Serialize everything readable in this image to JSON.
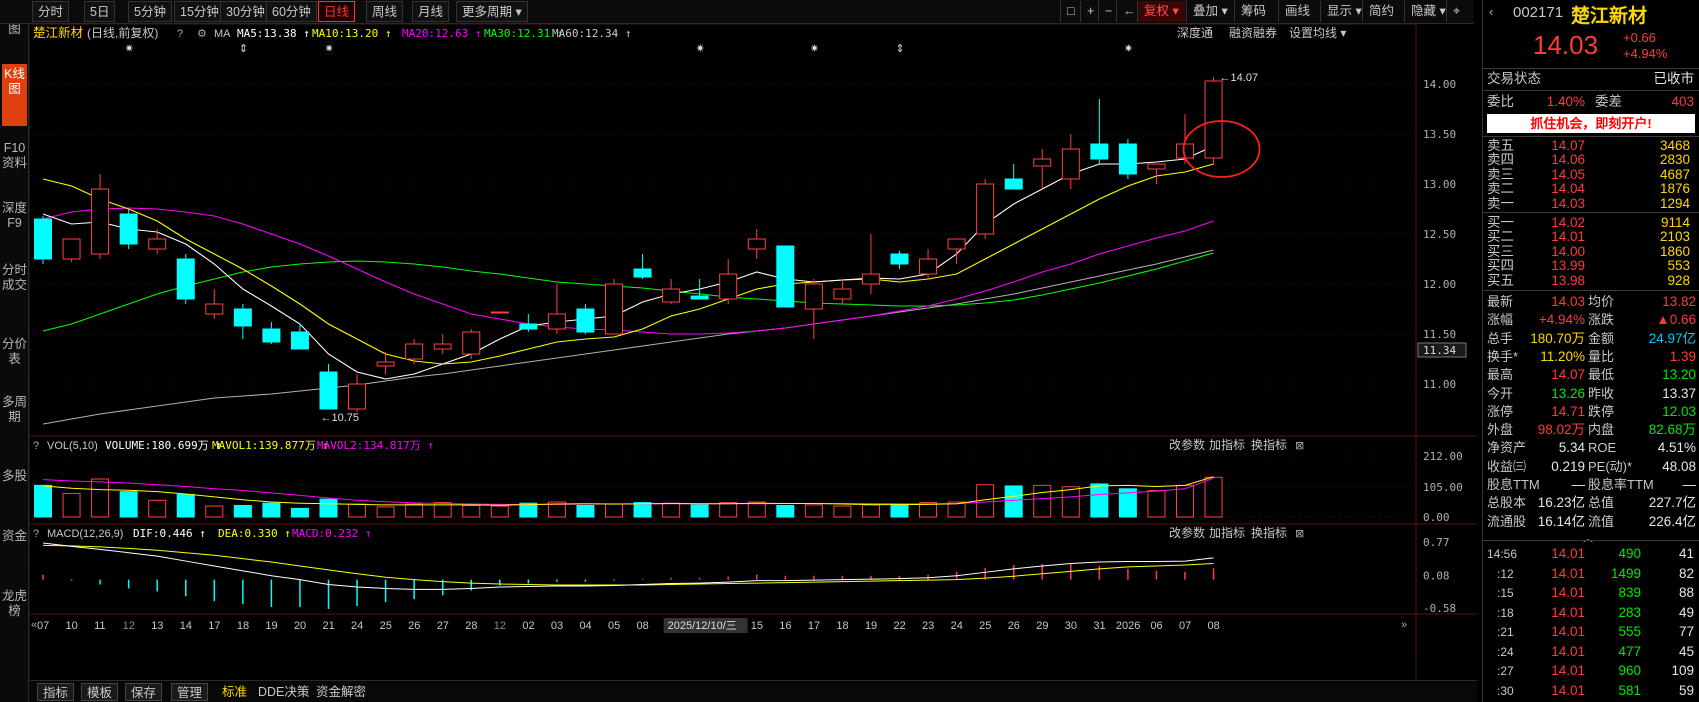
{
  "periods": [
    "分时",
    "5日",
    "5分钟",
    "15分钟",
    "30分钟",
    "60分钟",
    "日线",
    "周线",
    "月线",
    "更多周期"
  ],
  "active_period": "日线",
  "toolbar": {
    "fuquan": "复权",
    "diejia": "叠加",
    "chouma": "筹码",
    "huaxian": "画线",
    "xianshi": "显示",
    "jianfang": "简约",
    "yincang": "隐藏"
  },
  "left_tabs": [
    "分时图",
    "K线图",
    "F10资料",
    "深度F9",
    "分时成交",
    "分价表",
    "多周期",
    "多股",
    "资金",
    "龙虎榜"
  ],
  "chart_header": {
    "name": "楚江新材",
    "mode": "(日线,前复权)",
    "ma_label": "MA",
    "ma": [
      {
        "label": "MA5:13.38",
        "color": "#ffffff"
      },
      {
        "label": "MA10:13.20",
        "color": "#ffff00"
      },
      {
        "label": "MA20:12.63",
        "color": "#ff00ff"
      },
      {
        "label": "MA30:12.31",
        "color": "#00ff00"
      },
      {
        "label": "MA60:12.34",
        "color": "#cccccc"
      }
    ],
    "links": [
      "深度通",
      "融资融券",
      "设置均线"
    ]
  },
  "vol_header": {
    "label": "VOL(5,10)",
    "items": [
      {
        "label": "VOLUME:180.699万",
        "color": "#ffffff"
      },
      {
        "label": "MAVOL1:139.877万",
        "color": "#ffff00"
      },
      {
        "label": "MAVOL2:134.817万",
        "color": "#ff00ff"
      }
    ]
  },
  "macd_header": {
    "label": "MACD(12,26,9)",
    "items": [
      {
        "label": "DIF:0.446",
        "color": "#ffffff"
      },
      {
        "label": "DEA:0.330",
        "color": "#ffff00"
      },
      {
        "label": "MACD:0.232",
        "color": "#ff00ff"
      }
    ]
  },
  "panel_links": [
    "改参数",
    "加指标",
    "换指标"
  ],
  "chart_data": {
    "type": "candlestick",
    "x": [
      "07",
      "10",
      "11",
      "12",
      "13",
      "14",
      "17",
      "18",
      "19",
      "20",
      "21",
      "24",
      "25",
      "26",
      "27",
      "28",
      "01",
      "02",
      "03",
      "04",
      "05",
      "08",
      "09",
      "10",
      "11",
      "15",
      "16",
      "17",
      "18",
      "19",
      "22",
      "23",
      "24",
      "25",
      "26",
      "29",
      "30",
      "31",
      "05",
      "06",
      "07",
      "08"
    ],
    "x_ticks": [
      "07",
      "10",
      "11",
      "12",
      "13",
      "14",
      "17",
      "18",
      "19",
      "20",
      "21",
      "24",
      "25",
      "26",
      "27",
      "28",
      "12",
      "02",
      "03",
      "04",
      "05",
      "08",
      "09",
      "2025/12/10/三",
      "15",
      "16",
      "17",
      "18",
      "19",
      "22",
      "23",
      "24",
      "25",
      "26",
      "29",
      "30",
      "31",
      "2026",
      "06",
      "07",
      "08"
    ],
    "x_tick_index": [
      0,
      1,
      2,
      3,
      4,
      5,
      6,
      7,
      8,
      9,
      10,
      11,
      12,
      13,
      14,
      15,
      16,
      17,
      18,
      19,
      20,
      21,
      22,
      23,
      25,
      26,
      27,
      28,
      29,
      30,
      31,
      32,
      33,
      34,
      35,
      36,
      37,
      38,
      39,
      40,
      41
    ],
    "ohlc": [
      [
        12.65,
        12.68,
        12.2,
        12.25
      ],
      [
        12.25,
        12.45,
        12.22,
        12.45
      ],
      [
        12.3,
        13.1,
        12.25,
        12.95
      ],
      [
        12.7,
        12.75,
        12.35,
        12.4
      ],
      [
        12.35,
        12.55,
        12.3,
        12.45
      ],
      [
        12.25,
        12.3,
        11.8,
        11.85
      ],
      [
        11.7,
        11.95,
        11.65,
        11.8
      ],
      [
        11.75,
        11.8,
        11.45,
        11.58
      ],
      [
        11.55,
        11.62,
        11.4,
        11.42
      ],
      [
        11.52,
        11.6,
        11.35,
        11.35
      ],
      [
        11.12,
        11.2,
        10.75,
        10.75
      ],
      [
        10.75,
        11.1,
        10.72,
        11.0
      ],
      [
        11.18,
        11.32,
        11.1,
        11.22
      ],
      [
        11.25,
        11.45,
        11.2,
        11.4
      ],
      [
        11.35,
        11.5,
        11.3,
        11.4
      ],
      [
        11.3,
        11.55,
        11.25,
        11.52
      ],
      [
        11.72,
        11.72,
        11.72,
        11.72
      ],
      [
        11.6,
        11.7,
        11.52,
        11.55
      ],
      [
        11.55,
        12.0,
        11.5,
        11.7
      ],
      [
        11.75,
        11.8,
        11.5,
        11.52
      ],
      [
        11.5,
        12.05,
        11.5,
        12.0
      ],
      [
        12.15,
        12.3,
        12.05,
        12.07
      ],
      [
        11.82,
        12.05,
        11.8,
        11.95
      ],
      [
        11.88,
        12.05,
        11.85,
        11.85
      ],
      [
        11.85,
        12.25,
        11.8,
        12.1
      ],
      [
        12.35,
        12.55,
        12.25,
        12.45
      ],
      [
        12.38,
        12.38,
        11.77,
        11.77
      ],
      [
        11.75,
        12.05,
        11.45,
        12.0
      ],
      [
        11.85,
        12.05,
        11.8,
        11.95
      ],
      [
        12.0,
        12.5,
        11.9,
        12.1
      ],
      [
        12.3,
        12.33,
        12.15,
        12.2
      ],
      [
        12.1,
        12.35,
        12.05,
        12.25
      ],
      [
        12.35,
        12.45,
        12.2,
        12.45
      ],
      [
        12.5,
        13.05,
        12.45,
        13.0
      ],
      [
        13.05,
        13.2,
        12.95,
        12.95
      ],
      [
        13.18,
        13.35,
        12.95,
        13.25
      ],
      [
        13.05,
        13.5,
        12.95,
        13.35
      ],
      [
        13.4,
        13.85,
        13.2,
        13.25
      ],
      [
        13.4,
        13.45,
        13.05,
        13.1
      ],
      [
        13.15,
        13.2,
        13.0,
        13.2
      ],
      [
        13.26,
        13.7,
        13.2,
        13.4
      ],
      [
        13.26,
        14.07,
        13.2,
        14.03
      ]
    ],
    "ma5": [
      12.7,
      12.6,
      12.62,
      12.55,
      12.52,
      12.4,
      12.2,
      11.95,
      11.78,
      11.6,
      11.3,
      11.12,
      11.05,
      11.1,
      11.2,
      11.3,
      11.45,
      11.58,
      11.62,
      11.65,
      11.68,
      11.82,
      11.9,
      11.95,
      12.02,
      12.12,
      12.05,
      12.02,
      12.04,
      12.06,
      12.05,
      12.1,
      12.3,
      12.6,
      12.8,
      12.95,
      13.1,
      13.2,
      13.2,
      13.22,
      13.25,
      13.38
    ],
    "ma10": [
      13.05,
      12.98,
      12.85,
      12.75,
      12.63,
      12.45,
      12.3,
      12.15,
      11.98,
      11.8,
      11.6,
      11.45,
      11.3,
      11.23,
      11.2,
      11.22,
      11.28,
      11.35,
      11.42,
      11.45,
      11.47,
      11.55,
      11.68,
      11.75,
      11.85,
      11.95,
      12.0,
      12.02,
      12.04,
      12.05,
      12.02,
      12.05,
      12.1,
      12.25,
      12.4,
      12.55,
      12.7,
      12.85,
      12.98,
      13.08,
      13.12,
      13.2
    ],
    "ma20": [
      12.65,
      12.72,
      12.75,
      12.76,
      12.75,
      12.72,
      12.68,
      12.6,
      12.5,
      12.4,
      12.28,
      12.15,
      12.02,
      11.9,
      11.8,
      11.7,
      11.65,
      11.6,
      11.57,
      11.55,
      11.54,
      11.52,
      11.5,
      11.5,
      11.51,
      11.53,
      11.56,
      11.6,
      11.64,
      11.68,
      11.73,
      11.78,
      11.85,
      11.93,
      12.02,
      12.12,
      12.2,
      12.3,
      12.38,
      12.46,
      12.53,
      12.63
    ],
    "ma30": [
      11.53,
      11.6,
      11.7,
      11.8,
      11.9,
      11.98,
      12.05,
      12.12,
      12.17,
      12.2,
      12.22,
      12.23,
      12.22,
      12.2,
      12.17,
      12.13,
      12.1,
      12.06,
      12.02,
      12.0,
      11.98,
      11.96,
      11.93,
      11.9,
      11.87,
      11.85,
      11.83,
      11.81,
      11.8,
      11.79,
      11.78,
      11.78,
      11.79,
      11.81,
      11.84,
      11.89,
      11.95,
      12.01,
      12.08,
      12.15,
      12.23,
      12.31
    ],
    "ma60": [
      10.6,
      10.65,
      10.7,
      10.74,
      10.78,
      10.82,
      10.86,
      10.88,
      10.9,
      10.93,
      10.96,
      10.99,
      11.03,
      11.07,
      11.1,
      11.14,
      11.18,
      11.22,
      11.26,
      11.3,
      11.34,
      11.38,
      11.42,
      11.46,
      11.5,
      11.53,
      11.56,
      11.6,
      11.64,
      11.68,
      11.72,
      11.76,
      11.8,
      11.85,
      11.9,
      11.96,
      12.02,
      12.08,
      12.14,
      12.2,
      12.27,
      12.34
    ],
    "volume": [
      110,
      82,
      132,
      88,
      58,
      78,
      38,
      40,
      48,
      30,
      62,
      45,
      35,
      45,
      50,
      40,
      38,
      48,
      52,
      40,
      45,
      50,
      48,
      42,
      50,
      52,
      40,
      42,
      38,
      42,
      45,
      50,
      52,
      112,
      108,
      110,
      105,
      115,
      98,
      92,
      110,
      138
    ],
    "mavol1": [
      108,
      100,
      95,
      93,
      88,
      80,
      70,
      60,
      52,
      48,
      46,
      44,
      42,
      42,
      42,
      42,
      41,
      43,
      45,
      46,
      45,
      46,
      47,
      46,
      46,
      48,
      47,
      47,
      45,
      43,
      43,
      44,
      46,
      60,
      72,
      85,
      95,
      108,
      110,
      106,
      110,
      140
    ],
    "mavol2": [
      130,
      125,
      122,
      118,
      112,
      106,
      98,
      92,
      84,
      75,
      66,
      58,
      53,
      49,
      47,
      45,
      44,
      44,
      44,
      45,
      45,
      45,
      46,
      46,
      46,
      46,
      47,
      47,
      47,
      47,
      46,
      46,
      46,
      52,
      58,
      64,
      70,
      78,
      84,
      90,
      98,
      135
    ],
    "dif": [
      0.75,
      0.68,
      0.62,
      0.55,
      0.48,
      0.38,
      0.28,
      0.18,
      0.08,
      0.0,
      -0.1,
      -0.15,
      -0.18,
      -0.2,
      -0.2,
      -0.18,
      -0.15,
      -0.14,
      -0.13,
      -0.13,
      -0.12,
      -0.1,
      -0.08,
      -0.07,
      -0.05,
      -0.02,
      -0.02,
      -0.01,
      0.0,
      0.01,
      0.02,
      0.04,
      0.08,
      0.15,
      0.22,
      0.28,
      0.33,
      0.36,
      0.37,
      0.37,
      0.38,
      0.446
    ],
    "dea": [
      0.7,
      0.69,
      0.67,
      0.64,
      0.6,
      0.55,
      0.5,
      0.43,
      0.36,
      0.28,
      0.2,
      0.12,
      0.05,
      0.0,
      -0.04,
      -0.07,
      -0.09,
      -0.1,
      -0.11,
      -0.11,
      -0.11,
      -0.11,
      -0.1,
      -0.09,
      -0.08,
      -0.07,
      -0.06,
      -0.05,
      -0.04,
      -0.03,
      -0.02,
      -0.01,
      0.0,
      0.03,
      0.07,
      0.12,
      0.17,
      0.22,
      0.26,
      0.28,
      0.3,
      0.33
    ],
    "price_ticks": [
      "14.00",
      "13.50",
      "13.00",
      "12.50",
      "12.00",
      "11.50",
      "11.00"
    ],
    "price_range": [
      10.5,
      14.3
    ],
    "last_price_tag": "11.34",
    "hi_label": "14.07",
    "lo_label": "10.75",
    "vol_ticks": [
      "212.00",
      "105.00",
      "0.00"
    ],
    "vol_range": [
      0,
      212
    ],
    "macd_ticks": [
      "0.77",
      "0.08",
      "-0.58"
    ],
    "macd_range": [
      -0.58,
      0.77
    ],
    "event_marks": [
      {
        "i": 3,
        "sym": "✷"
      },
      {
        "i": 7,
        "sym": "⇕"
      },
      {
        "i": 10,
        "sym": "✷"
      },
      {
        "i": 23,
        "sym": "✷"
      },
      {
        "i": 27,
        "sym": "✷"
      },
      {
        "i": 30,
        "sym": "⇕"
      },
      {
        "i": 38,
        "sym": "✷"
      }
    ]
  },
  "quote": {
    "code": "002171",
    "name": "楚江新材",
    "price": "14.03",
    "change": "+0.66",
    "pct": "+4.94%",
    "status_label": "交易状态",
    "status": "已收市",
    "weibi_label": "委比",
    "weibi": "1.40%",
    "weicha_label": "委差",
    "weicha": "403",
    "promo": "抓住机会，即刻开户!"
  },
  "asks": [
    {
      "label": "卖五",
      "price": "14.07",
      "vol": "3468"
    },
    {
      "label": "卖四",
      "price": "14.06",
      "vol": "2830"
    },
    {
      "label": "卖三",
      "price": "14.05",
      "vol": "4687"
    },
    {
      "label": "卖二",
      "price": "14.04",
      "vol": "1876"
    },
    {
      "label": "卖一",
      "price": "14.03",
      "vol": "1294"
    }
  ],
  "bids": [
    {
      "label": "买一",
      "price": "14.02",
      "vol": "9114"
    },
    {
      "label": "买二",
      "price": "14.01",
      "vol": "2103"
    },
    {
      "label": "买三",
      "price": "14.00",
      "vol": "1860"
    },
    {
      "label": "买四",
      "price": "13.99",
      "vol": "553"
    },
    {
      "label": "买五",
      "price": "13.98",
      "vol": "928"
    }
  ],
  "stats": [
    {
      "l1": "最新",
      "v1": "14.03",
      "c1": "red",
      "l2": "均价",
      "v2": "13.82",
      "c2": "red"
    },
    {
      "l1": "涨幅",
      "v1": "+4.94%",
      "c1": "red",
      "l2": "涨跌",
      "v2": "▲0.66",
      "c2": "red"
    },
    {
      "l1": "总手",
      "v1": "180.70万",
      "c1": "yel",
      "l2": "金额",
      "v2": "24.97亿",
      "c2": "cyn"
    },
    {
      "l1": "换手*",
      "v1": "11.20%",
      "c1": "yel",
      "l2": "量比",
      "v2": "1.39",
      "c2": "red"
    },
    {
      "l1": "最高",
      "v1": "14.07",
      "c1": "red",
      "l2": "最低",
      "v2": "13.20",
      "c2": "grn"
    },
    {
      "l1": "今开",
      "v1": "13.26",
      "c1": "grn",
      "l2": "昨收",
      "v2": "13.37",
      "c2": "wht"
    },
    {
      "l1": "涨停",
      "v1": "14.71",
      "c1": "red",
      "l2": "跌停",
      "v2": "12.03",
      "c2": "grn"
    },
    {
      "l1": "外盘",
      "v1": "98.02万",
      "c1": "red",
      "l2": "内盘",
      "v2": "82.68万",
      "c2": "grn"
    },
    {
      "l1": "净资产",
      "v1": "5.34",
      "c1": "wht",
      "l2": "ROE",
      "v2": "4.51%",
      "c2": "wht"
    },
    {
      "l1": "收益㈢",
      "v1": "0.219",
      "c1": "wht",
      "l2": "PE(动)*",
      "v2": "48.08",
      "c2": "wht"
    },
    {
      "l1": "股息TTM",
      "v1": "—",
      "c1": "wht",
      "l2": "股息率TTM",
      "v2": "—",
      "c2": "wht"
    },
    {
      "l1": "总股本",
      "v1": "16.23亿",
      "c1": "wht",
      "l2": "总值",
      "v2": "227.7亿",
      "c2": "wht"
    },
    {
      "l1": "流通股",
      "v1": "16.14亿",
      "c1": "wht",
      "l2": "流值",
      "v2": "226.4亿",
      "c2": "wht"
    }
  ],
  "ticks": [
    {
      "t": "14:56",
      "p": "14.01",
      "v": "490",
      "n": "41"
    },
    {
      "t": ":12",
      "p": "14.01",
      "v": "1499",
      "n": "82"
    },
    {
      "t": ":15",
      "p": "14.01",
      "v": "839",
      "n": "88"
    },
    {
      "t": ":18",
      "p": "14.01",
      "v": "283",
      "n": "49"
    },
    {
      "t": ":21",
      "p": "14.01",
      "v": "555",
      "n": "77"
    },
    {
      "t": ":24",
      "p": "14.01",
      "v": "477",
      "n": "45"
    },
    {
      "t": ":27",
      "p": "14.01",
      "v": "960",
      "n": "109"
    },
    {
      "t": ":30",
      "p": "14.01",
      "v": "581",
      "n": "59"
    }
  ],
  "bottom": [
    "指标",
    "模板",
    "保存",
    "管理",
    "标准",
    "DDE决策",
    "资金解密"
  ],
  "colors": {
    "up": "#ff4040",
    "down": "#00ffff",
    "ma5": "#ffffff",
    "ma10": "#ffff00",
    "ma20": "#ff00ff",
    "ma30": "#00ff00",
    "ma60": "#b0b0b0"
  }
}
